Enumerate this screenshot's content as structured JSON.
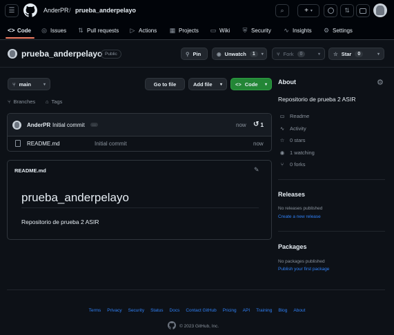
{
  "header": {
    "owner": "AnderPR",
    "slash": "/",
    "repo": "prueba_anderpelayo"
  },
  "tabs": [
    {
      "label": "Code"
    },
    {
      "label": "Issues"
    },
    {
      "label": "Pull requests"
    },
    {
      "label": "Actions"
    },
    {
      "label": "Projects"
    },
    {
      "label": "Wiki"
    },
    {
      "label": "Security"
    },
    {
      "label": "Insights"
    },
    {
      "label": "Settings"
    }
  ],
  "repo_header": {
    "name": "prueba_anderpelayo",
    "visibility": "Public",
    "pin": "Pin",
    "unwatch": "Unwatch",
    "watch_count": "1",
    "fork": "Fork",
    "fork_count": "0",
    "star": "Star",
    "star_count": "0"
  },
  "toolbar": {
    "branch": "main",
    "branches": "Branches",
    "tags": "Tags",
    "go_to_file": "Go to file",
    "add_file": "Add file",
    "code": "Code"
  },
  "commit": {
    "author": "AnderPR",
    "message": "Initial commit",
    "ellipsis": "...",
    "time": "now",
    "count": "1"
  },
  "files": [
    {
      "name": "README.md",
      "message": "Initial commit",
      "time": "now"
    }
  ],
  "readme": {
    "filename": "README.md",
    "heading": "prueba_anderpelayo",
    "body": "Repositorio de prueba 2 ASIR"
  },
  "about": {
    "title": "About",
    "description": "Repositorio de prueba 2 ASIR",
    "readme": "Readme",
    "activity": "Activity",
    "stars": "0 stars",
    "watching": "1 watching",
    "forks": "0 forks"
  },
  "releases": {
    "title": "Releases",
    "empty": "No releases published",
    "link": "Create a new release"
  },
  "packages": {
    "title": "Packages",
    "empty": "No packages published",
    "link": "Publish your first package"
  },
  "footer": {
    "links": [
      "Terms",
      "Privacy",
      "Security",
      "Status",
      "Docs",
      "Contact GitHub",
      "Pricing",
      "API",
      "Training",
      "Blog",
      "About"
    ],
    "copyright": "© 2023 GitHub, Inc."
  },
  "colors": {
    "background": "#0d1117",
    "header": "#010409",
    "accent_green": "#238636",
    "link_blue": "#2f81f7",
    "tab_underline": "#f78166"
  }
}
